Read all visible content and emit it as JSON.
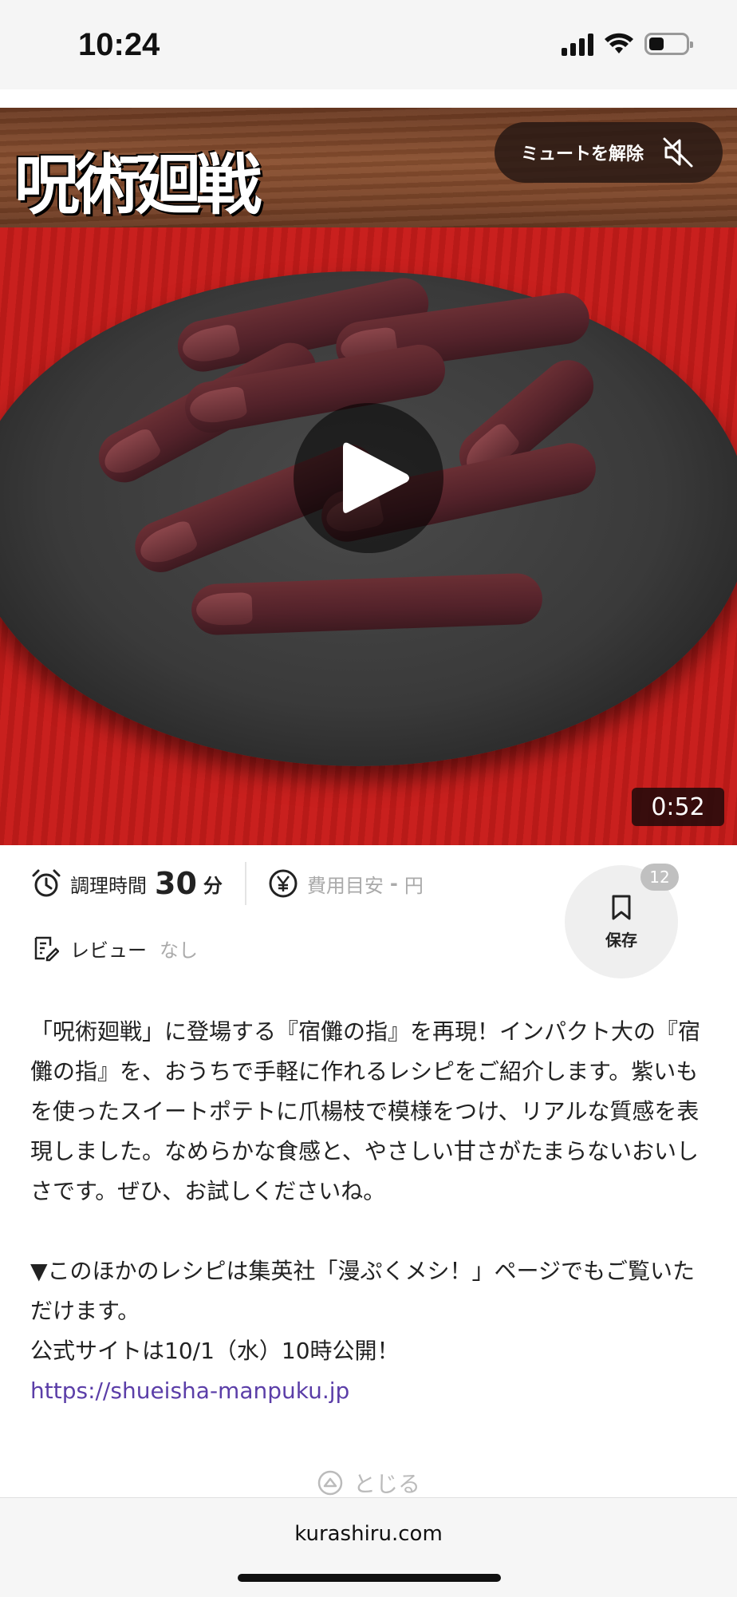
{
  "status_bar": {
    "time": "10:24"
  },
  "video": {
    "logo_text": "呪術廻戦",
    "mute_label": "ミュートを解除",
    "duration": "0:52"
  },
  "recipe_meta": {
    "cook_time_label": "調理時間",
    "cook_time_value": "30",
    "cook_time_unit": "分",
    "cost_label": "費用目安",
    "cost_value": "-",
    "cost_unit": "円",
    "review_label": "レビュー",
    "review_value": "なし",
    "save_label": "保存",
    "save_count": "12"
  },
  "description": {
    "paragraph1": "「呪術廻戦」に登場する『宿儺の指』を再現！インパクト大の『宿儺の指』を、おうちで手軽に作れるレシピをご紹介します。紫いもを使ったスイートポテトに爪楊枝で模様をつけ、リアルな質感を表現しました。なめらかな食感と、やさしい甘さがたまらないおいしさです。ぜひ、お試しくださいね。",
    "paragraph2": "▼このほかのレシピは集英社「漫ぷくメシ！」ページでもご覧いただけます。",
    "paragraph3": "公式サイトは10/1（水）10時公開！",
    "link": "https://shueisha-manpuku.jp"
  },
  "close_label": "とじる",
  "browser": {
    "domain": "kurashiru.com"
  },
  "colors": {
    "link": "#5b3ea8",
    "cloth": "#c41d1b"
  }
}
